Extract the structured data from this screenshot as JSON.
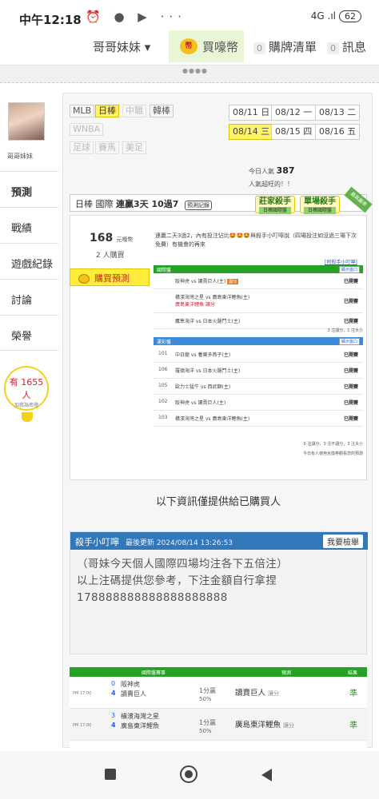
{
  "status": {
    "time": "中午12:18",
    "icons": "⏰ ● ▶ ···",
    "network": "4G .ıl",
    "battery": "62"
  },
  "topnav": {
    "user": "哥哥妹妹 ▾",
    "coin_icon": "coin-icon",
    "buy": "買嚎幣",
    "cart_count": "0",
    "cart": "購牌清單",
    "msg_count": "0",
    "msg": "訊息"
  },
  "dots": "●●●●",
  "sidebar": {
    "name": "哥哥妹妹",
    "items": [
      "預測",
      "戰績",
      "遊戲紀錄",
      "討論",
      "榮譽"
    ],
    "bulb_num": "有 1655 人",
    "bulb_text": "加我為密燈"
  },
  "tabs": [
    "MLB",
    "日棒",
    "中職",
    "韓棒",
    "WNBA",
    "足球",
    "賽馬",
    "美足"
  ],
  "dates": [
    "08/11 日",
    "08/12 一",
    "08/13 二",
    "08/14 三",
    "08/15 四",
    "08/16 五"
  ],
  "hot": {
    "label": "今日人氣",
    "value": "387",
    "sub": "人氣超旺的！！"
  },
  "pickbar": {
    "left": "日棒 國際",
    "bold": "連贏3天 10過7",
    "rec": "預測記錄"
  },
  "badges": [
    "莊家殺手",
    "單場殺手"
  ],
  "badge_sub": "日棒國際盤",
  "corner": "最高贏率",
  "price": {
    "value": "168",
    "unit": "元嚎幣",
    "buyers": "2 人購買"
  },
  "desc": "連贏二天3過2，內有投注佔比🤩🤩🤩與殺手小叮嚀說（四場投注如沒過三場下次免費）有機會的再來",
  "buy_btn": "購買預測",
  "link_help": "[附殺手小叮嚀]",
  "intl": {
    "title": "國際盤",
    "show": "顯示盤口",
    "rows": [
      {
        "game": "阪神虎 vs 讀賣巨人(主)",
        "tag": "讓分",
        "res": "已開賽"
      },
      {
        "game": "橫濱海灣之星 vs 廣島東洋鯉魚(主)",
        "sub": "廣島東洋鯉魚 讓分",
        "res": "已開賽"
      },
      {
        "game": "鷹隼海洋 vs 日本火腿鬥士(主)",
        "res": "已開賽"
      }
    ],
    "note": "3 注讓分，1 注大小"
  },
  "lottery": {
    "title": "運彩盤",
    "show": "顯示盤口",
    "rows": [
      {
        "no": "101",
        "game": "中日龍 vs 養樂多燕子(主)",
        "res": "已開賽"
      },
      {
        "no": "106",
        "game": "羅德海洋 vs 日本火腿鬥士(主)",
        "res": "已開賽"
      },
      {
        "no": "105",
        "game": "歐力士猛牛 vs 西武獅(主)",
        "res": "已開賽"
      },
      {
        "no": "102",
        "game": "阪神虎 vs 讀賣巨人(主)",
        "res": "已開賽"
      },
      {
        "no": "103",
        "game": "橫濱海灣之星 vs 廣島東洋鯉魚(主)",
        "res": "已開賽"
      }
    ],
    "note1": "0 注讓分，3 注不讓分，3 注大小",
    "note2": "今日有人使用兌換券觀看您的預測"
  },
  "notice": "以下資訊僅提供給已購買人",
  "killer": {
    "title": "殺手小叮嚀",
    "updated": "最後更新 2024/08/14 13:26:53",
    "report": "我要檢舉",
    "lines": [
      "（哥妹今天個人國際四場均注各下五倍注）",
      "以上注碼提供您參考，下注金額自行拿捏",
      "178888888888888888888"
    ]
  },
  "matches": {
    "head": [
      "國際盤賽事",
      "預測",
      "結果"
    ],
    "rows": [
      {
        "time": "PM 17:00",
        "s1": "0",
        "t1": "阪神虎",
        "s2": "4",
        "t2": "讀賣巨人",
        "hc": "1分贏",
        "pct": "50%",
        "pick": "讀賣巨人",
        "pick_sub": "讓分",
        "result": "準"
      },
      {
        "time": "PM 17:00",
        "s1": "3",
        "t1": "橫濱海灣之星",
        "s2": "4",
        "t2": "廣島東洋鯉魚",
        "hc": "1分贏",
        "pct": "50%",
        "pick": "廣島東洋鯉魚",
        "pick_sub": "讓分",
        "result": "準"
      }
    ]
  }
}
